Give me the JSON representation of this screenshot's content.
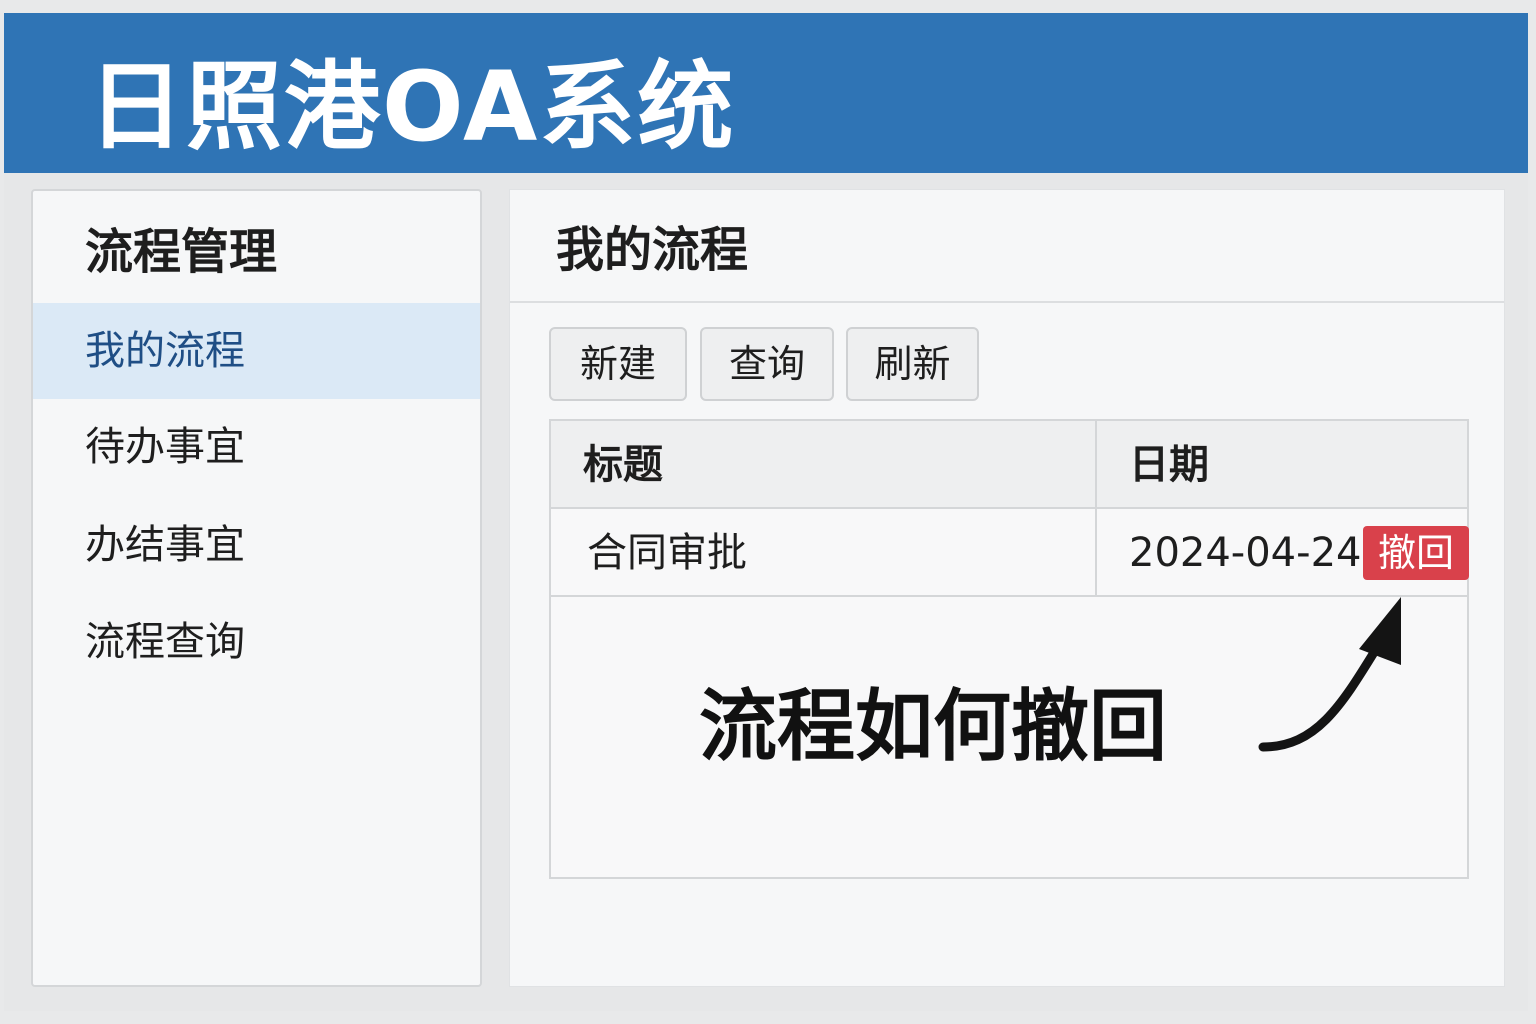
{
  "app": {
    "title": "日照港OA系统"
  },
  "sidebar": {
    "title": "流程管理",
    "items": [
      {
        "label": "我的流程",
        "active": true
      },
      {
        "label": "待办事宜",
        "active": false
      },
      {
        "label": "办结事宜",
        "active": false
      },
      {
        "label": "流程查询",
        "active": false
      }
    ]
  },
  "main": {
    "title": "我的流程",
    "toolbar": {
      "new_label": "新建",
      "query_label": "查询",
      "refresh_label": "刷新"
    },
    "table": {
      "headers": [
        "标题",
        "日期"
      ],
      "rows": [
        {
          "title": "合同审批",
          "date": "2024-04-24",
          "action": "撤回"
        }
      ]
    },
    "caption": "流程如何撤回",
    "arrow_icon": "curved-arrow-icon"
  },
  "colors": {
    "header_bg": "#2f74b5",
    "active_item_bg": "#dbe9f6",
    "revoke_bg": "#d9414b"
  }
}
